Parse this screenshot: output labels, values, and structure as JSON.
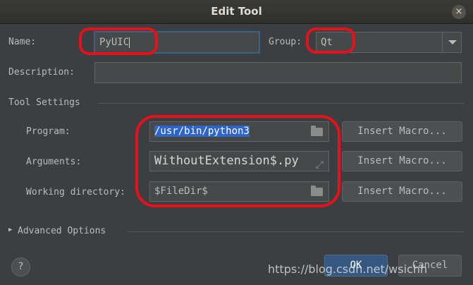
{
  "window": {
    "title": "Edit Tool",
    "close_glyph": "×"
  },
  "name": {
    "label": "Name:",
    "value": "PyUIC"
  },
  "group": {
    "label": "Group:",
    "value": "Qt"
  },
  "description": {
    "label": "Description:",
    "value": ""
  },
  "tool_settings": {
    "heading": "Tool Settings",
    "program": {
      "label": "Program:",
      "value": "/usr/bin/python3",
      "button": "Insert Macro..."
    },
    "arguments": {
      "label": "Arguments:",
      "value": "WithoutExtension$.py",
      "button": "Insert Macro..."
    },
    "working_directory": {
      "label": "Working directory:",
      "value": "$FileDir$",
      "button": "Insert Macro..."
    }
  },
  "advanced": {
    "arrow": "▶",
    "label": "Advanced Options"
  },
  "footer": {
    "help": "?",
    "ok": "OK",
    "cancel": "Cancel"
  },
  "watermark": "https://blog.csdn.net/wsichh",
  "icons": [
    "close-icon",
    "dropdown-arrow-icon",
    "folder-icon",
    "expand-icon",
    "help-icon",
    "expand-arrow-icon"
  ],
  "colors": {
    "background": "#3c3f41",
    "selection": "#2f65ca",
    "highlight": "#e8101a",
    "primary_button": "#365880"
  }
}
